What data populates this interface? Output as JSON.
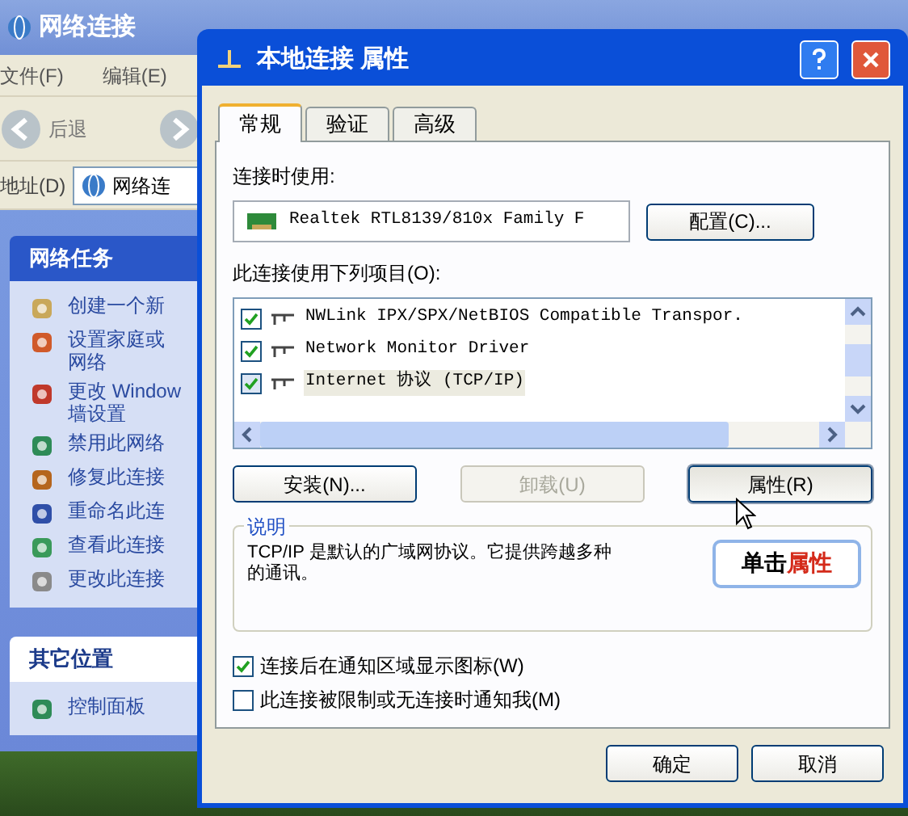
{
  "explorer": {
    "title": "网络连接",
    "menu": [
      "文件(F)",
      "编辑(E)"
    ],
    "back_label": "后退",
    "address_label": "地址(D)",
    "address_value": "网络连",
    "task_panels": [
      {
        "title": "网络任务",
        "items": [
          {
            "lines": [
              "创建一个新"
            ]
          },
          {
            "lines": [
              "设置家庭或",
              "网络"
            ]
          },
          {
            "lines": [
              "更改 Window",
              "墙设置"
            ]
          },
          {
            "lines": [
              "禁用此网络"
            ]
          },
          {
            "lines": [
              "修复此连接"
            ]
          },
          {
            "lines": [
              "重命名此连"
            ]
          },
          {
            "lines": [
              "查看此连接"
            ]
          },
          {
            "lines": [
              "更改此连接"
            ]
          }
        ]
      },
      {
        "title": "其它位置",
        "items": [
          {
            "lines": [
              "控制面板"
            ]
          }
        ]
      }
    ]
  },
  "dialog": {
    "title": "本地连接 属性",
    "tabs": [
      {
        "label": "常规",
        "selected": true
      },
      {
        "label": "验证",
        "selected": false
      },
      {
        "label": "高级",
        "selected": false
      }
    ],
    "connect_using_label": "连接时使用:",
    "adapter": "Realtek RTL8139/810x Family F",
    "configure_button": "配置(C)...",
    "components_label": "此连接使用下列项目(O):",
    "components": [
      {
        "label": "NWLink IPX/SPX/NetBIOS Compatible Transpor.",
        "checked": true,
        "selected": false
      },
      {
        "label": "Network Monitor Driver",
        "checked": true,
        "selected": false
      },
      {
        "label": "Internet 协议 (TCP/IP)",
        "checked": true,
        "selected": true
      }
    ],
    "buttons": [
      {
        "label": "安装(N)...",
        "disabled": false
      },
      {
        "label": "卸载(U)",
        "disabled": true
      },
      {
        "label": "属性(R)",
        "disabled": false
      }
    ],
    "description_title": "说明",
    "description_lines": [
      "TCP/IP 是默认的广域网协议。它提供跨越多种",
      "的通讯。"
    ],
    "options": [
      {
        "label": "连接后在通知区域显示图标(W)",
        "checked": true
      },
      {
        "label": "此连接被限制或无连接时通知我(M)",
        "checked": false
      }
    ],
    "footer_buttons": [
      "确定",
      "取消"
    ]
  },
  "callout": {
    "text": "单击",
    "emphasis": "属性"
  }
}
